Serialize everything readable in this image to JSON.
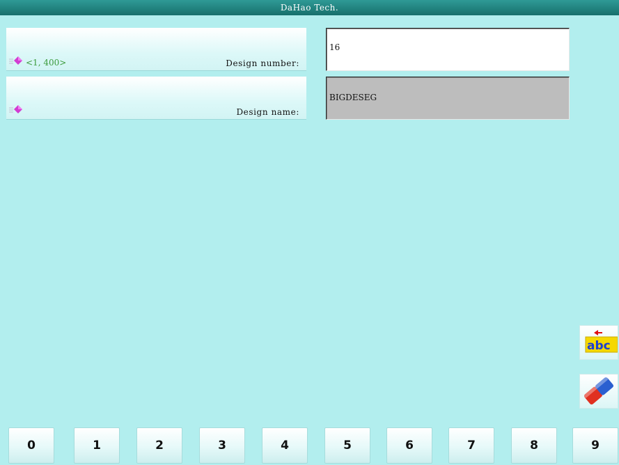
{
  "window": {
    "title": "DaHao Tech."
  },
  "fields": {
    "design_number": {
      "range": "<1, 400>",
      "label": "Design number:",
      "value": "16"
    },
    "design_name": {
      "range": "",
      "label": "Design name:",
      "value": "BIGDESEG"
    }
  },
  "side_buttons": {
    "input_mode": {
      "icon": "abc-input-icon",
      "text": "abc"
    },
    "clear": {
      "icon": "eraser-icon"
    }
  },
  "keypad": {
    "keys": [
      "0",
      "1",
      "2",
      "3",
      "4",
      "5",
      "6",
      "7",
      "8",
      "9"
    ]
  },
  "colors": {
    "background": "#b2eeee",
    "titlebar": "#1f807c",
    "range_text": "#3a9a3a",
    "name_field_bg": "#bdbdbd",
    "icon_pink": "#d23cd2",
    "abc_yellow": "#f5d800",
    "abc_blue": "#1c3fd0",
    "arrow_red": "#e01010",
    "eraser_red": "#e03020",
    "eraser_blue": "#2a5fd0"
  }
}
